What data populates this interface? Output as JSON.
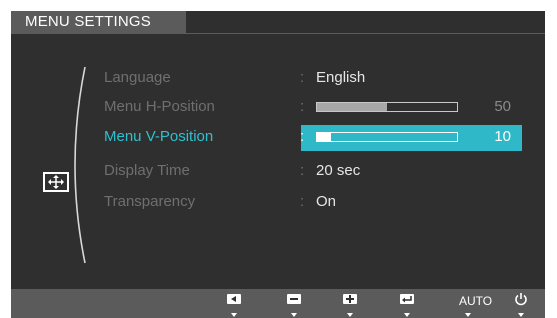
{
  "window": {
    "title": "MENU SETTINGS"
  },
  "category": {
    "icon": "monitor-position-icon"
  },
  "menu": {
    "items": [
      {
        "label": "Language",
        "value": "English",
        "type": "text"
      },
      {
        "label": "Menu H-Position",
        "value": "50",
        "type": "slider",
        "level": 0.5
      },
      {
        "label": "Menu V-Position",
        "value": "10",
        "type": "slider",
        "level": 0.1,
        "selected": true
      },
      {
        "label": "Display Time",
        "value": "20 sec",
        "type": "text"
      },
      {
        "label": "Transparency",
        "value": "On",
        "type": "text"
      }
    ],
    "separator": ":"
  },
  "footer": {
    "buttons": [
      {
        "name": "left-arrow-button",
        "icon": "left-triangle-icon"
      },
      {
        "name": "minus-button",
        "icon": "minus-icon"
      },
      {
        "name": "plus-button",
        "icon": "plus-icon"
      },
      {
        "name": "enter-button",
        "icon": "enter-icon"
      },
      {
        "name": "auto-button",
        "label": "AUTO"
      },
      {
        "name": "power-button",
        "icon": "power-icon"
      }
    ]
  },
  "colors": {
    "background": "#2f2f2f",
    "bar": "#5b5b5b",
    "accent": "#2fb8c8",
    "label_dim": "#6f6f6f"
  }
}
